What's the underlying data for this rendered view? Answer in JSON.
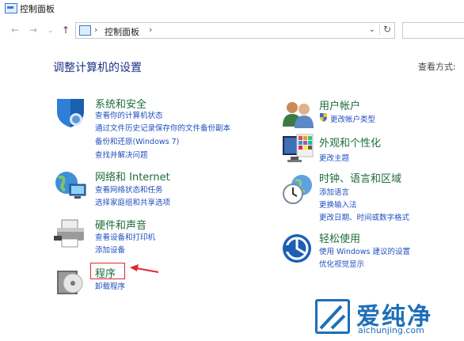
{
  "window": {
    "title": "控制面板"
  },
  "address": {
    "crumb": "控制面板",
    "sep": "›"
  },
  "heading": "调整计算机的设置",
  "view_by_label": "查看方式:",
  "categories": {
    "system": {
      "title": "系统和安全",
      "links": [
        "查看你的计算机状态",
        "通过文件历史记录保存你的文件备份副本",
        "备份和还原(Windows 7)",
        "查找并解决问题"
      ]
    },
    "network": {
      "title": "网络和 Internet",
      "links": [
        "查看网络状态和任务",
        "选择家庭组和共享选项"
      ]
    },
    "hardware": {
      "title": "硬件和声音",
      "links": [
        "查看设备和打印机",
        "添加设备"
      ]
    },
    "programs": {
      "title": "程序",
      "links": [
        "卸载程序"
      ]
    },
    "accounts": {
      "title": "用户帐户",
      "links": [
        "更改帐户类型"
      ]
    },
    "appearance": {
      "title": "外观和个性化",
      "links": [
        "更改主题"
      ]
    },
    "clock": {
      "title": "时钟、语言和区域",
      "links": [
        "添加语言",
        "更换输入法",
        "更改日期、时间或数字格式"
      ]
    },
    "ease": {
      "title": "轻松使用",
      "links": [
        "使用 Windows 建议的设置",
        "优化视觉显示"
      ]
    }
  },
  "watermark": {
    "cn": "爱纯净",
    "en": "aichunjing.com"
  },
  "colors": {
    "heading": "#1e3287",
    "category_title": "#1e6b3c",
    "link": "#1f4fbf",
    "annotation": "#e0272b",
    "watermark": "#1d6fb8"
  }
}
